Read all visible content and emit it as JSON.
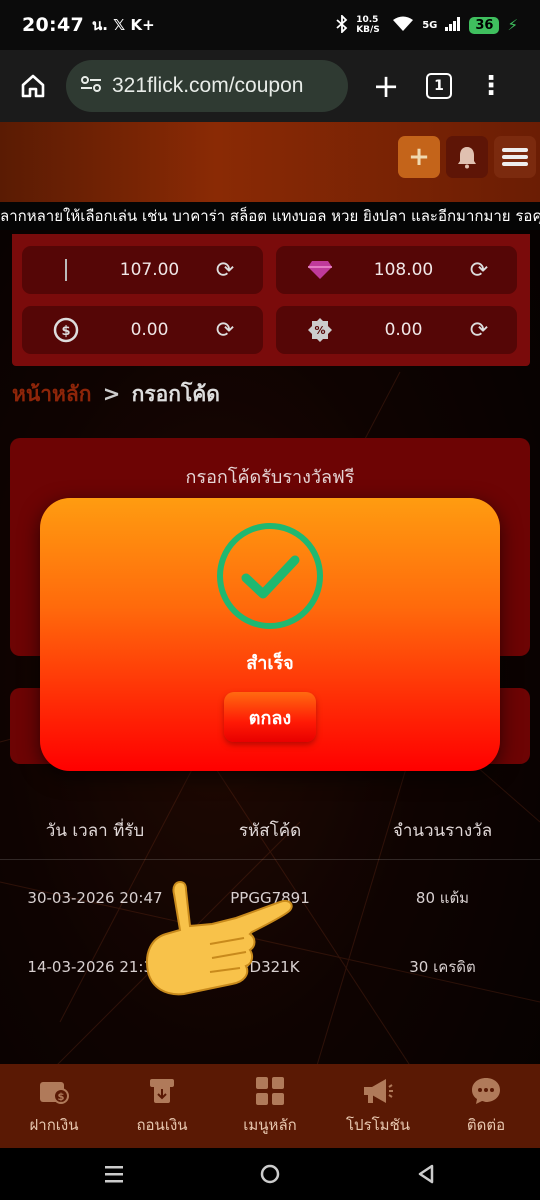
{
  "status_bar": {
    "time": "20:47",
    "carrier_text": "น. 𝕏 K+",
    "network_speed": "10.5 KB/S",
    "network_type": "5G",
    "battery": "36"
  },
  "browser": {
    "url": "321flick.com/coupon",
    "tab_count": "1"
  },
  "header": {
    "marquee": "ลากหลายให้เลือกเล่น เช่น บาคาร่า สล็อต แทงบอล หวย ยิงปลา และอีกมากมาย รอคุ"
  },
  "wallet": {
    "items": [
      {
        "icon": "wallet-bar-icon",
        "value": "107.00"
      },
      {
        "icon": "diamond-icon",
        "value": "108.00"
      },
      {
        "icon": "coin-icon",
        "value": "0.00"
      },
      {
        "icon": "badge-percent-icon",
        "value": "0.00"
      }
    ]
  },
  "breadcrumb": {
    "home": "หน้าหลัก",
    "separator": ">",
    "current": "กรอกโค้ด"
  },
  "coupon_box": {
    "title": "กรอกโค้ดรับรางวัลฟรี"
  },
  "history": {
    "columns": [
      "วัน เวลา ที่รับ",
      "รหัสโค้ด",
      "จำนวนรางวัล"
    ],
    "rows": [
      {
        "datetime": "30-03-2026 20:47",
        "code": "PPGG7891",
        "reward": "80 แต้ม"
      },
      {
        "datetime": "14-03-2026 21:32",
        "code": "PD321K",
        "reward": "30 เครดิต"
      }
    ]
  },
  "bottom_nav": {
    "items": [
      {
        "label": "ฝากเงิน",
        "icon": "deposit-icon"
      },
      {
        "label": "ถอนเงิน",
        "icon": "withdraw-icon"
      },
      {
        "label": "เมนูหลัก",
        "icon": "grid-menu-icon"
      },
      {
        "label": "โปรโมชัน",
        "icon": "megaphone-icon"
      },
      {
        "label": "ติดต่อ",
        "icon": "support-chat-icon"
      }
    ]
  },
  "modal": {
    "message": "สำเร็จ",
    "ok_label": "ตกลง",
    "icon": "check-circle-icon"
  },
  "colors": {
    "modal_top": "#ff9c10",
    "modal_bottom": "#ff0000",
    "check_green": "#1fb871",
    "wallet_bg": "#7a0b0b",
    "nav_bg": "#5a1904"
  }
}
